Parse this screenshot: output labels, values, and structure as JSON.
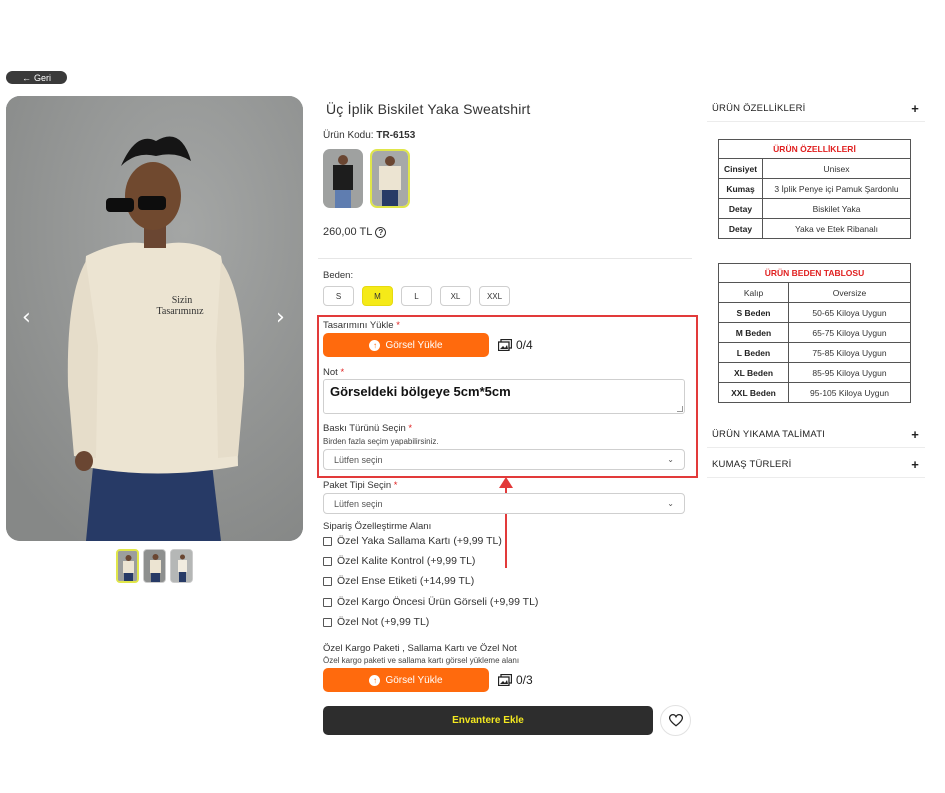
{
  "back": {
    "label": "Geri"
  },
  "product": {
    "title": "Üç İplik Biskilet Yaka Sweatshirt",
    "code_label": "Ürün Kodu:",
    "code": "TR-6153",
    "price": "260,00 TL",
    "image_text": "Sizin\nTasarımınız"
  },
  "sizes": {
    "label": "Beden:",
    "options": [
      "S",
      "M",
      "L",
      "XL",
      "XXL"
    ],
    "selected": "M"
  },
  "upload": {
    "label": "Tasarımını Yükle",
    "button": "Görsel Yükle",
    "count": "0/4"
  },
  "note": {
    "label": "Not",
    "value": "Görseldeki bölgeye 5cm*5cm"
  },
  "print_type": {
    "label": "Baskı Türünü Seçin",
    "hint": "Birden fazla seçim yapabilirsiniz.",
    "placeholder": "Lütfen seçin"
  },
  "package_type": {
    "label": "Paket Tipi Seçin",
    "placeholder": "Lütfen seçin"
  },
  "customization": {
    "label": "Sipariş Özelleştirme Alanı",
    "options": [
      "Özel Yaka Sallama Kartı (+9,99 TL)",
      "Özel Kalite Kontrol (+9,99 TL)",
      "Özel Ense Etiketi (+14,99 TL)",
      "Özel Kargo Öncesi Ürün Görseli (+9,99 TL)",
      "Özel Not (+9,99 TL)"
    ]
  },
  "cargo": {
    "title": "Özel Kargo Paketi , Sallama Kartı ve Özel Not",
    "subtitle": "Özel kargo paketi ve sallama kartı görsel yükleme alanı",
    "button": "Görsel Yükle",
    "count": "0/3"
  },
  "cart": {
    "label": "Envantere Ekle"
  },
  "accordions": {
    "features": "ÜRÜN ÖZELLİKLERİ",
    "washing": "ÜRÜN YIKAMA TALİMATI",
    "fabrics": "KUMAŞ TÜRLERİ"
  },
  "features_table": {
    "title": "ÜRÜN ÖZELLİKLERİ",
    "rows": [
      [
        "Cinsiyet",
        "Unisex"
      ],
      [
        "Kumaş",
        "3 İplik Penye içi Pamuk Şardonlu"
      ],
      [
        "Detay",
        "Biskilet Yaka"
      ],
      [
        "Detay",
        "Yaka ve Etek Ribanalı"
      ]
    ]
  },
  "size_table": {
    "title": "ÜRÜN BEDEN TABLOSU",
    "rows": [
      [
        "Kalıp",
        "Oversize"
      ],
      [
        "S Beden",
        "50-65 Kiloya Uygun"
      ],
      [
        "M Beden",
        "65-75 Kiloya Uygun"
      ],
      [
        "L Beden",
        "75-85 Kiloya Uygun"
      ],
      [
        "XL Beden",
        "85-95 Kiloya Uygun"
      ],
      [
        "XXL Beden",
        "95-105 Kiloya Uygun"
      ]
    ]
  },
  "colors": {
    "orange": "#ff6a0d",
    "highlight": "#f5ea18",
    "annotation": "#e23a3a",
    "dark": "#2d2d2d"
  }
}
